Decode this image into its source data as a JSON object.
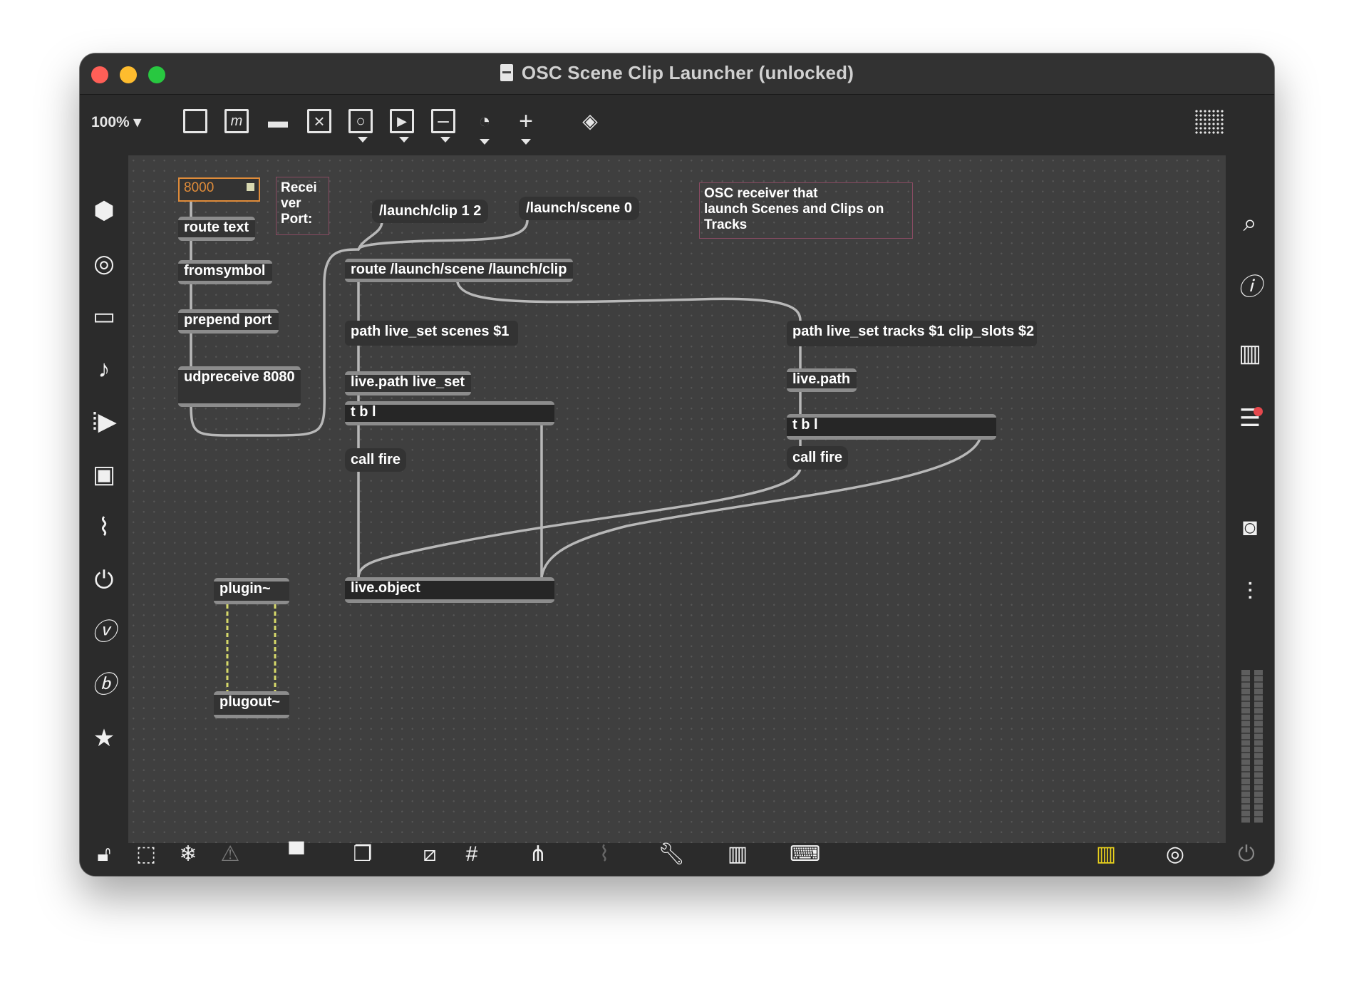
{
  "window": {
    "title": "OSC Scene Clip Launcher (unlocked)"
  },
  "toolbar": {
    "zoom": "100%",
    "tools": [
      "object-box",
      "message-box",
      "comment",
      "toggle",
      "button",
      "playbar",
      "slider",
      "dial",
      "add",
      "paint"
    ]
  },
  "patch": {
    "receiver_port_value": "8000",
    "receiver_port_comment": "Recei\nver\nPort:",
    "description": "OSC receiver that\nlaunch Scenes and Clips on\nTracks",
    "objects": {
      "route_text": "route text",
      "fromsymbol": "fromsymbol",
      "prepend_port": "prepend port",
      "udpreceive": "udpreceive 8080",
      "route_launch": "route /launch/scene /launch/clip",
      "path_scenes": "path live_set scenes $1",
      "livepath_liveset": "live.path live_set",
      "tbl_left": "t b l",
      "callfire_left": "call fire",
      "live_object": "live.object",
      "path_tracks": "path live_set tracks $1 clip_slots $2",
      "livepath": "live.path",
      "tbl_right": "t b l",
      "callfire_right": "call fire",
      "plugin": "plugin~",
      "plugout": "plugout~"
    },
    "messages": {
      "launch_clip": "/launch/clip 1 2",
      "launch_scene": "/launch/scene 0"
    }
  },
  "colors": {
    "canvas": "#3f3f3f",
    "cord": "#b8b8b8",
    "signal_cord": "#d6d96a",
    "numbox_accent": "#e08c3a",
    "comment_border": "#8a4b63"
  }
}
